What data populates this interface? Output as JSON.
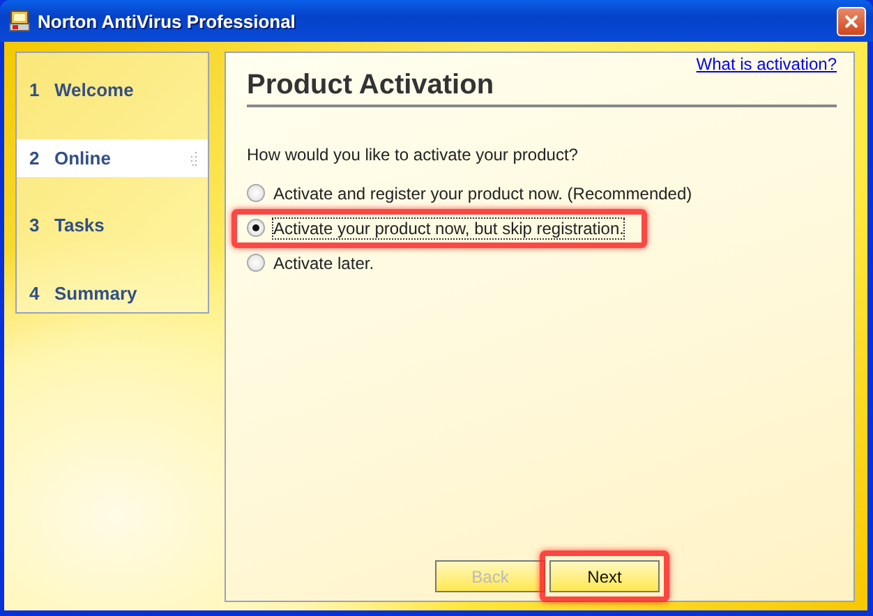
{
  "window": {
    "title": "Norton AntiVirus Professional"
  },
  "steps": [
    {
      "number": "1",
      "label": "Welcome",
      "selected": false
    },
    {
      "number": "2",
      "label": "Online",
      "selected": true
    },
    {
      "number": "3",
      "label": "Tasks",
      "selected": false
    },
    {
      "number": "4",
      "label": "Summary",
      "selected": false
    }
  ],
  "page": {
    "title": "Product Activation",
    "help_link": "What is activation?",
    "question": "How would you like to activate your product?",
    "options": [
      {
        "label": "Activate and register your product now. (Recommended)",
        "selected": false,
        "highlighted": false
      },
      {
        "label": "Activate your product now, but skip registration.",
        "selected": true,
        "highlighted": true
      },
      {
        "label": "Activate later.",
        "selected": false,
        "highlighted": false
      }
    ]
  },
  "buttons": [
    {
      "label": "Back",
      "disabled": true,
      "highlighted": false
    },
    {
      "label": "Next",
      "disabled": false,
      "highlighted": true
    }
  ]
}
